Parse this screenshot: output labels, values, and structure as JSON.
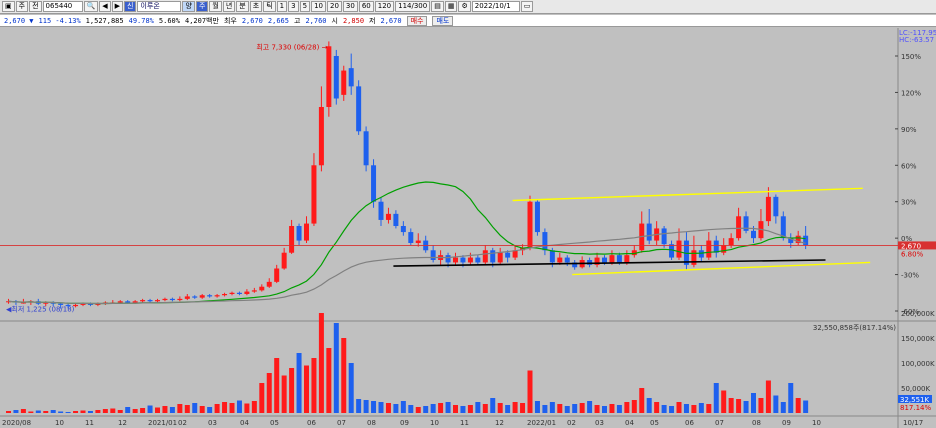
{
  "toolbar": {
    "icon1": "▣",
    "icon2": "주",
    "combo": "전",
    "code": "065440",
    "search": "🔍",
    "prev": "◀",
    "next": "▶",
    "mark": "신",
    "name": "이루온",
    "mode": "양",
    "periods": [
      "주",
      "월",
      "년",
      "분",
      "초",
      "틱"
    ],
    "minutes": [
      "1",
      "3",
      "5",
      "10",
      "20",
      "30",
      "60",
      "120"
    ],
    "count": "114/300",
    "date": "2022/10/1"
  },
  "quote": {
    "price": "2,670 ▼",
    "change": "115 -4.13%",
    "volume": "1,527,885",
    "ratio": "49.78%",
    "turnover": "5.60%",
    "amount": "4,207백만",
    "base_label": "최우",
    "base": "2,670",
    "bid": "2,665",
    "high_label": "고",
    "high": "2,760",
    "open_label": "시",
    "open": "2,850",
    "low_label": "저",
    "low": "2,670",
    "sell": "매수",
    "buy": "매도"
  },
  "colors": {
    "up": "#ff1a1a",
    "down": "#1e60ee",
    "ma20": "#00a000",
    "ma60": "#808080",
    "channel": "#ffff00",
    "base": "#000000",
    "cur": "#d83030"
  },
  "chart_data": {
    "type": "candlestick",
    "price_axis": [
      "150%",
      "120%",
      "90%",
      "60%",
      "30%",
      "0%",
      "-30%",
      "-60%"
    ],
    "lc_label": "LC:-117.95",
    "hc_label": "HC:-63.57",
    "current_label": "2,670",
    "current_pct": "6.80%",
    "high_note": "최고 7,330 (06/28)",
    "low_note": "최저 1,225 (08/18)",
    "vol_axis": [
      "200,000K",
      "150,000K",
      "100,000K",
      "50,000K"
    ],
    "vol_note": "32,550,858주(817.14%)",
    "vol_cur": "32,551K",
    "vol_pct": "817.14%",
    "x_labels": [
      "2020/08",
      "10",
      "11",
      "12",
      "2021/01",
      "02",
      "03",
      "04",
      "05",
      "06",
      "07",
      "08",
      "09",
      "10",
      "11",
      "12",
      "2022/01",
      "02",
      "03",
      "04",
      "05",
      "06",
      "07",
      "08",
      "09",
      "10",
      "10/17"
    ]
  }
}
